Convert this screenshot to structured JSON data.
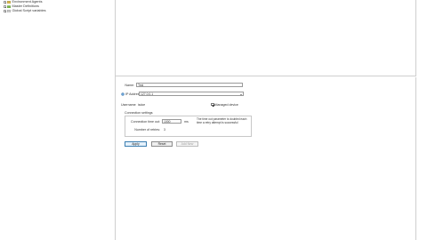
{
  "tree": {
    "items": [
      {
        "label": "Environment Agents",
        "icon": "server-icon"
      },
      {
        "label": "Master Definitions",
        "icon": "folder-icon"
      },
      {
        "label": "Global Script variables",
        "icon": "variable-icon"
      }
    ]
  },
  "form": {
    "name_label": "Name:",
    "name_value": "Test",
    "address_label": "IP Address:",
    "address_value": "127.0.0.1",
    "username_label": "Username:",
    "username_value": "jsdoe",
    "managed_label": "Managed device",
    "managed_checked": true,
    "connection_group_label": "Connection settings",
    "timeout_label": "Connection time out:",
    "timeout_value": "1000",
    "timeout_unit": "ms",
    "retries_label": "Number of retries:",
    "retries_value": "3",
    "note_text": "The time out parameter is doubled each time a retry attempt is successful"
  },
  "buttons": {
    "apply": "Apply",
    "reset": "Reset",
    "add_new": "Add New"
  },
  "colors": {
    "accent": "#3c7fb1",
    "border": "#cfcfcf"
  }
}
